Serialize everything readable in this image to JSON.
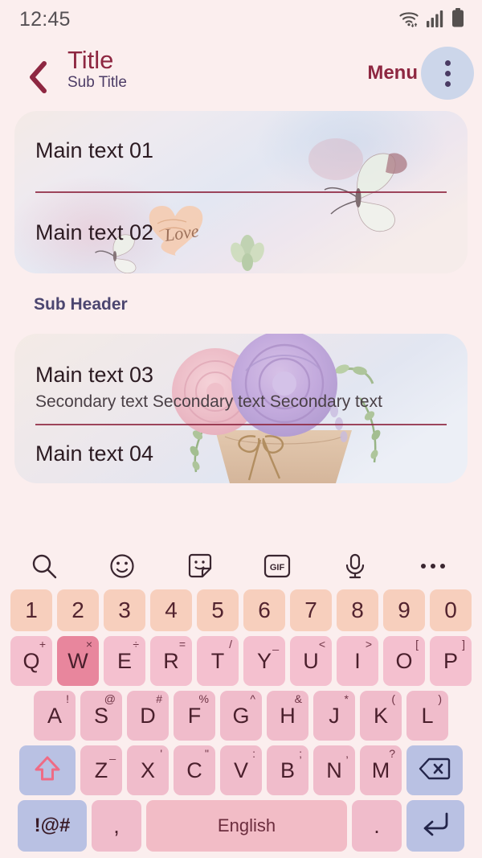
{
  "statusbar": {
    "time": "12:45",
    "icons": [
      "wifi-icon",
      "signal-icon",
      "battery-icon"
    ]
  },
  "appbar": {
    "back_icon": "chevron-left-icon",
    "title": "Title",
    "subtitle": "Sub Title",
    "menu_label": "Menu",
    "overflow_icon": "more-vertical-icon"
  },
  "list": {
    "card1": {
      "rows": [
        {
          "main": "Main text 01",
          "secondary": ""
        },
        {
          "main": "Main text 02",
          "secondary": ""
        }
      ]
    },
    "sub_header": "Sub Header",
    "card2": {
      "rows": [
        {
          "main": "Main text 03",
          "secondary": "Secondary text Secondary text Secondary text"
        },
        {
          "main": "Main text 04",
          "secondary": ""
        }
      ]
    }
  },
  "keyboard": {
    "toolbar": [
      {
        "name": "search-icon",
        "label": ""
      },
      {
        "name": "emoji-icon",
        "label": ""
      },
      {
        "name": "sticker-icon",
        "label": ""
      },
      {
        "name": "gif-icon",
        "label": "GIF"
      },
      {
        "name": "microphone-icon",
        "label": ""
      },
      {
        "name": "more-horizontal-icon",
        "label": ""
      }
    ],
    "row_numbers": [
      {
        "key": "1"
      },
      {
        "key": "2"
      },
      {
        "key": "3"
      },
      {
        "key": "4"
      },
      {
        "key": "5"
      },
      {
        "key": "6"
      },
      {
        "key": "7"
      },
      {
        "key": "8"
      },
      {
        "key": "9"
      },
      {
        "key": "0"
      }
    ],
    "row_q": [
      {
        "key": "Q",
        "sup": "+"
      },
      {
        "key": "W",
        "sup": "×",
        "highlighted": true
      },
      {
        "key": "E",
        "sup": "÷"
      },
      {
        "key": "R",
        "sup": "="
      },
      {
        "key": "T",
        "sup": "/"
      },
      {
        "key": "Y",
        "sup": "_"
      },
      {
        "key": "U",
        "sup": "<"
      },
      {
        "key": "I",
        "sup": ">"
      },
      {
        "key": "O",
        "sup": "["
      },
      {
        "key": "P",
        "sup": "]"
      }
    ],
    "row_a": [
      {
        "key": "A",
        "sup": "!"
      },
      {
        "key": "S",
        "sup": "@"
      },
      {
        "key": "D",
        "sup": "#"
      },
      {
        "key": "F",
        "sup": "%"
      },
      {
        "key": "G",
        "sup": "^"
      },
      {
        "key": "H",
        "sup": "&"
      },
      {
        "key": "J",
        "sup": "*"
      },
      {
        "key": "K",
        "sup": "("
      },
      {
        "key": "L",
        "sup": ")"
      }
    ],
    "row_z": [
      {
        "key": "Z",
        "sup": "_"
      },
      {
        "key": "X",
        "sup": "'"
      },
      {
        "key": "C",
        "sup": "\""
      },
      {
        "key": "V",
        "sup": ":"
      },
      {
        "key": "B",
        "sup": ";"
      },
      {
        "key": "N",
        "sup": ","
      },
      {
        "key": "M",
        "sup": "?"
      }
    ],
    "shift_icon": "shift-up-arrow-icon",
    "backspace_icon": "backspace-icon",
    "symbols_label": "!@#",
    "comma_label": ",",
    "space_label": "English",
    "period_label": ".",
    "enter_icon": "enter-return-icon"
  },
  "colors": {
    "page_bg": "#fbeeee",
    "accent_maroon": "#8e2741",
    "subheader_purple": "#4c4670",
    "key_number": "#f7cfbd",
    "key_letter": "#f0bccb",
    "key_highlight": "#e8869d",
    "key_function": "#b9c1e3",
    "menu_circle": "#ccd6ea"
  }
}
